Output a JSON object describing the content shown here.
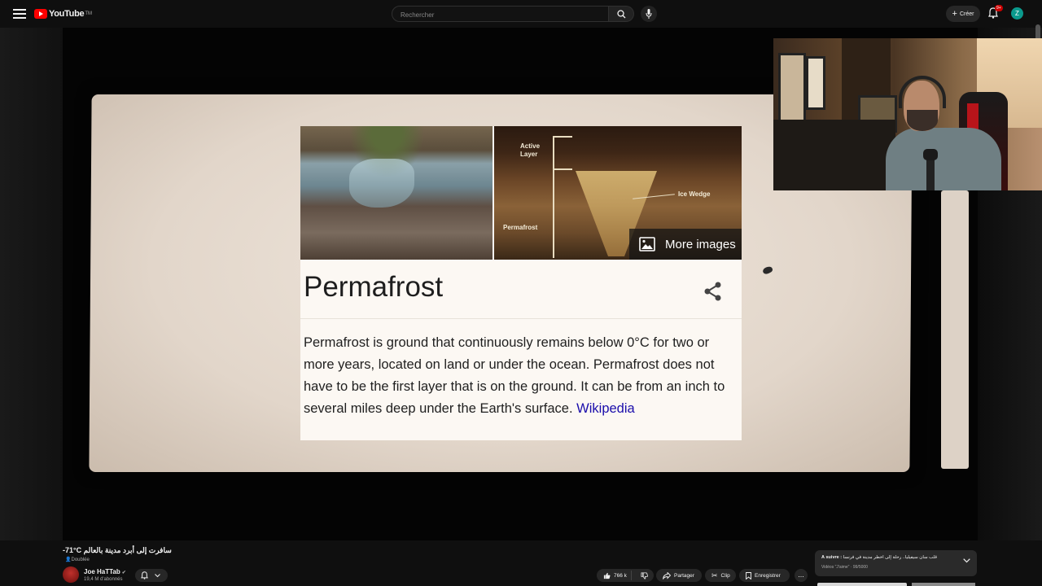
{
  "header": {
    "logo_text": "YouTube",
    "logo_sup": "TM",
    "search_placeholder": "Rechercher",
    "create_label": "Créer",
    "notification_count": "9+",
    "avatar_letter": "Z"
  },
  "video_frame": {
    "more_images_label": "More images",
    "image_labels": {
      "active_layer": "Active Layer",
      "ice_wedge": "Ice Wedge",
      "permafrost": "Permafrost"
    },
    "card_title": "Permafrost",
    "card_description": "Permafrost is ground that continuously remains below 0°C for two or more years, located on land or under the ocean. Permafrost does not have to be the first layer that is on the ground. It can be from an inch to several miles deep under the Earth's surface.",
    "source_link": "Wikipedia"
  },
  "video_info": {
    "title": "-71°C سافرت إلى أبرد مدينة بالعالم",
    "dubbed_label": "Doublée",
    "channel_name": "Joe HaTTab",
    "subscribers": "19,4 M d'abonnés"
  },
  "actions": {
    "likes": "766 k",
    "share_label": "Partager",
    "clip_label": "Clip",
    "save_label": "Enregistrer",
    "more_label": "..."
  },
  "up_next": {
    "label": "À suivre :",
    "title": "قلب سان سيفيليا.. رحلة إلى أخطر مدينة في فرنسا",
    "subtitle": "Vidéos \"J'aime\" · 99/5000"
  },
  "colors": {
    "brand_red": "#ff0000",
    "background": "#0f0f0f",
    "link_blue": "#1a0dab",
    "avatar_teal": "#0b9a8d"
  }
}
